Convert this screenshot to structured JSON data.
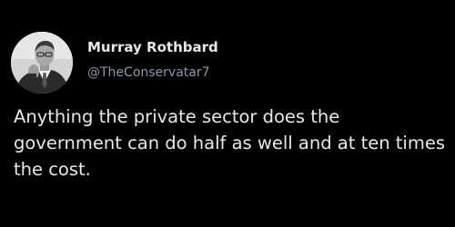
{
  "tweet": {
    "author": {
      "display_name": "Murray Rothbard",
      "handle": "@TheConservatar7",
      "avatar_icon": "profile-photo"
    },
    "text": "Anything the private sector does the government can do half as well and at ten times the cost."
  },
  "colors": {
    "background": "#000000",
    "primary_text": "#e7e9ea",
    "secondary_text": "#8b98a5"
  }
}
